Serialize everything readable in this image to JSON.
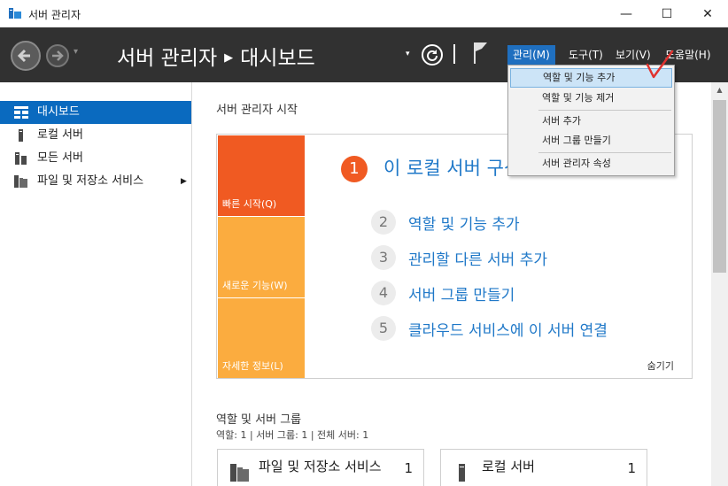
{
  "window": {
    "title": "서버 관리자",
    "minimize_glyph": "—",
    "maximize_glyph": "☐",
    "close_glyph": "✕"
  },
  "header": {
    "breadcrumb_app": "서버 관리자",
    "breadcrumb_sep": "▶",
    "breadcrumb_page": "대시보드",
    "dropdown_glyph": "▾",
    "nav_dropdown_glyph": "▾",
    "menus": [
      {
        "label": "관리(M)",
        "active": true
      },
      {
        "label": "도구(T)",
        "active": false
      },
      {
        "label": "보기(V)",
        "active": false
      },
      {
        "label": "도움말(H)",
        "active": false
      }
    ]
  },
  "sidebar": {
    "items": [
      {
        "label": "대시보드",
        "icon": "dashboard-icon",
        "active": true
      },
      {
        "label": "로컬 서버",
        "icon": "server-icon",
        "active": false
      },
      {
        "label": "모든 서버",
        "icon": "servers-icon",
        "active": false
      },
      {
        "label": "파일 및 저장소 서비스",
        "icon": "file-storage-icon",
        "active": false,
        "expand_glyph": "▶"
      }
    ]
  },
  "main": {
    "section_title": "서버 관리자 시작",
    "tiles": [
      "빠른 시작(Q)",
      "새로운 기능(W)",
      "자세한 정보(L)"
    ],
    "step1": {
      "num": "1",
      "label": "이 로컬 서버 구성"
    },
    "steps": [
      {
        "num": "2",
        "label": "역할 및 기능 추가"
      },
      {
        "num": "3",
        "label": "관리할 다른 서버 추가"
      },
      {
        "num": "4",
        "label": "서버 그룹 만들기"
      },
      {
        "num": "5",
        "label": "클라우드 서비스에 이 서버 연결"
      }
    ],
    "hide_label": "숨기기",
    "groups_title": "역할 및 서버 그룹",
    "groups_counts": "역할: 1   |   서버 그룹: 1   |   전체 서버: 1",
    "cards": [
      {
        "name": "파일 및 저장소 서비스",
        "count": "1"
      },
      {
        "name": "로컬 서버",
        "count": "1"
      }
    ]
  },
  "dropdown": {
    "items": [
      {
        "label": "역할 및 기능 추가",
        "highlighted": true
      },
      {
        "label": "역할 및 기능 제거",
        "highlighted": false
      },
      {
        "label": "서버 추가",
        "highlighted": false
      },
      {
        "label": "서버 그룹 만들기",
        "highlighted": false
      },
      {
        "label": "서버 관리자 속성",
        "highlighted": false
      }
    ]
  },
  "colors": {
    "header_bg": "#313131",
    "accent_blue": "#0a6abf",
    "menu_active": "#1f6fbf",
    "tile_orange": "#f05a22",
    "tile_amber": "#fbac3f",
    "link_blue": "#1f78c8",
    "annotation_red": "#e0322f"
  },
  "scrollbar": {
    "up_glyph": "▲"
  }
}
